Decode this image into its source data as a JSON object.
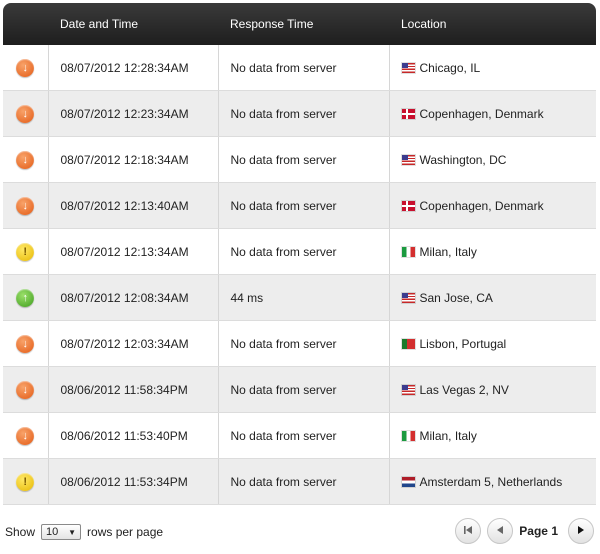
{
  "table": {
    "headers": {
      "status": "",
      "datetime": "Date and Time",
      "response": "Response Time",
      "location": "Location"
    },
    "rows": [
      {
        "status": "down",
        "icon": "↓",
        "datetime": "08/07/2012 12:28:34AM",
        "response": "No data from server",
        "flag": "us",
        "location": "Chicago, IL"
      },
      {
        "status": "down",
        "icon": "↓",
        "datetime": "08/07/2012 12:23:34AM",
        "response": "No data from server",
        "flag": "dk",
        "location": "Copenhagen, Denmark"
      },
      {
        "status": "down",
        "icon": "↓",
        "datetime": "08/07/2012 12:18:34AM",
        "response": "No data from server",
        "flag": "us",
        "location": "Washington, DC"
      },
      {
        "status": "down",
        "icon": "↓",
        "datetime": "08/07/2012 12:13:40AM",
        "response": "No data from server",
        "flag": "dk",
        "location": "Copenhagen, Denmark"
      },
      {
        "status": "warn",
        "icon": "!",
        "datetime": "08/07/2012 12:13:34AM",
        "response": "No data from server",
        "flag": "it",
        "location": "Milan, Italy"
      },
      {
        "status": "up",
        "icon": "↑",
        "datetime": "08/07/2012 12:08:34AM",
        "response": "44 ms",
        "flag": "us",
        "location": "San Jose, CA"
      },
      {
        "status": "down",
        "icon": "↓",
        "datetime": "08/07/2012 12:03:34AM",
        "response": "No data from server",
        "flag": "pt",
        "location": "Lisbon, Portugal"
      },
      {
        "status": "down",
        "icon": "↓",
        "datetime": "08/06/2012 11:58:34PM",
        "response": "No data from server",
        "flag": "us",
        "location": "Las Vegas 2, NV"
      },
      {
        "status": "down",
        "icon": "↓",
        "datetime": "08/06/2012 11:53:40PM",
        "response": "No data from server",
        "flag": "it",
        "location": "Milan, Italy"
      },
      {
        "status": "warn",
        "icon": "!",
        "datetime": "08/06/2012 11:53:34PM",
        "response": "No data from server",
        "flag": "nl",
        "location": "Amsterdam 5, Netherlands"
      }
    ]
  },
  "footer": {
    "show_label": "Show",
    "rows_per_page_value": "10",
    "rows_per_page_label": "rows per page",
    "page_label": "Page 1"
  },
  "colors": {
    "header_bg": "#2b2b2b",
    "down": "#e35a14",
    "up": "#3d9c1c",
    "warn": "#e6b800",
    "alt_row": "#ededed"
  },
  "icons": {
    "first_page": "first-page-icon",
    "prev_page": "prev-page-icon",
    "next_page": "next-page-icon",
    "dropdown": "chevron-down-icon"
  }
}
